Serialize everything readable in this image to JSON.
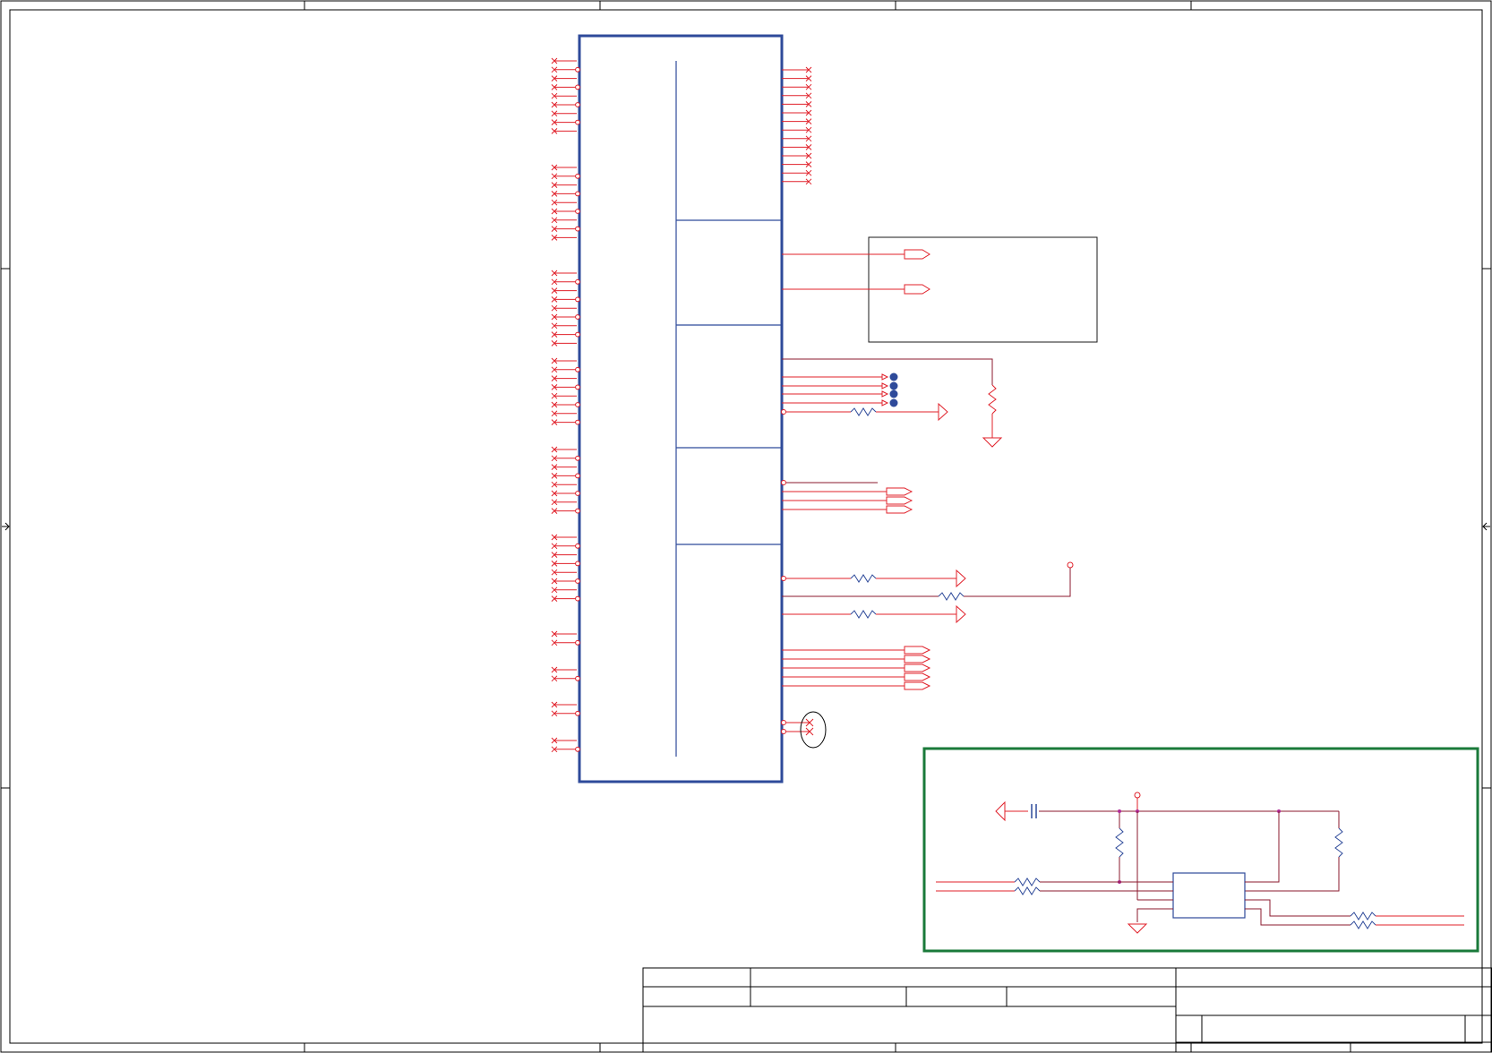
{
  "colors": {
    "pin_red": "#e0202a",
    "ic_blue": "#2e4a9a",
    "wire_maroon": "#8b1a2e",
    "box_green": "#1a7a3a",
    "junction_blue": "#2e4a9a",
    "node_magenta": "#b02a9a"
  }
}
